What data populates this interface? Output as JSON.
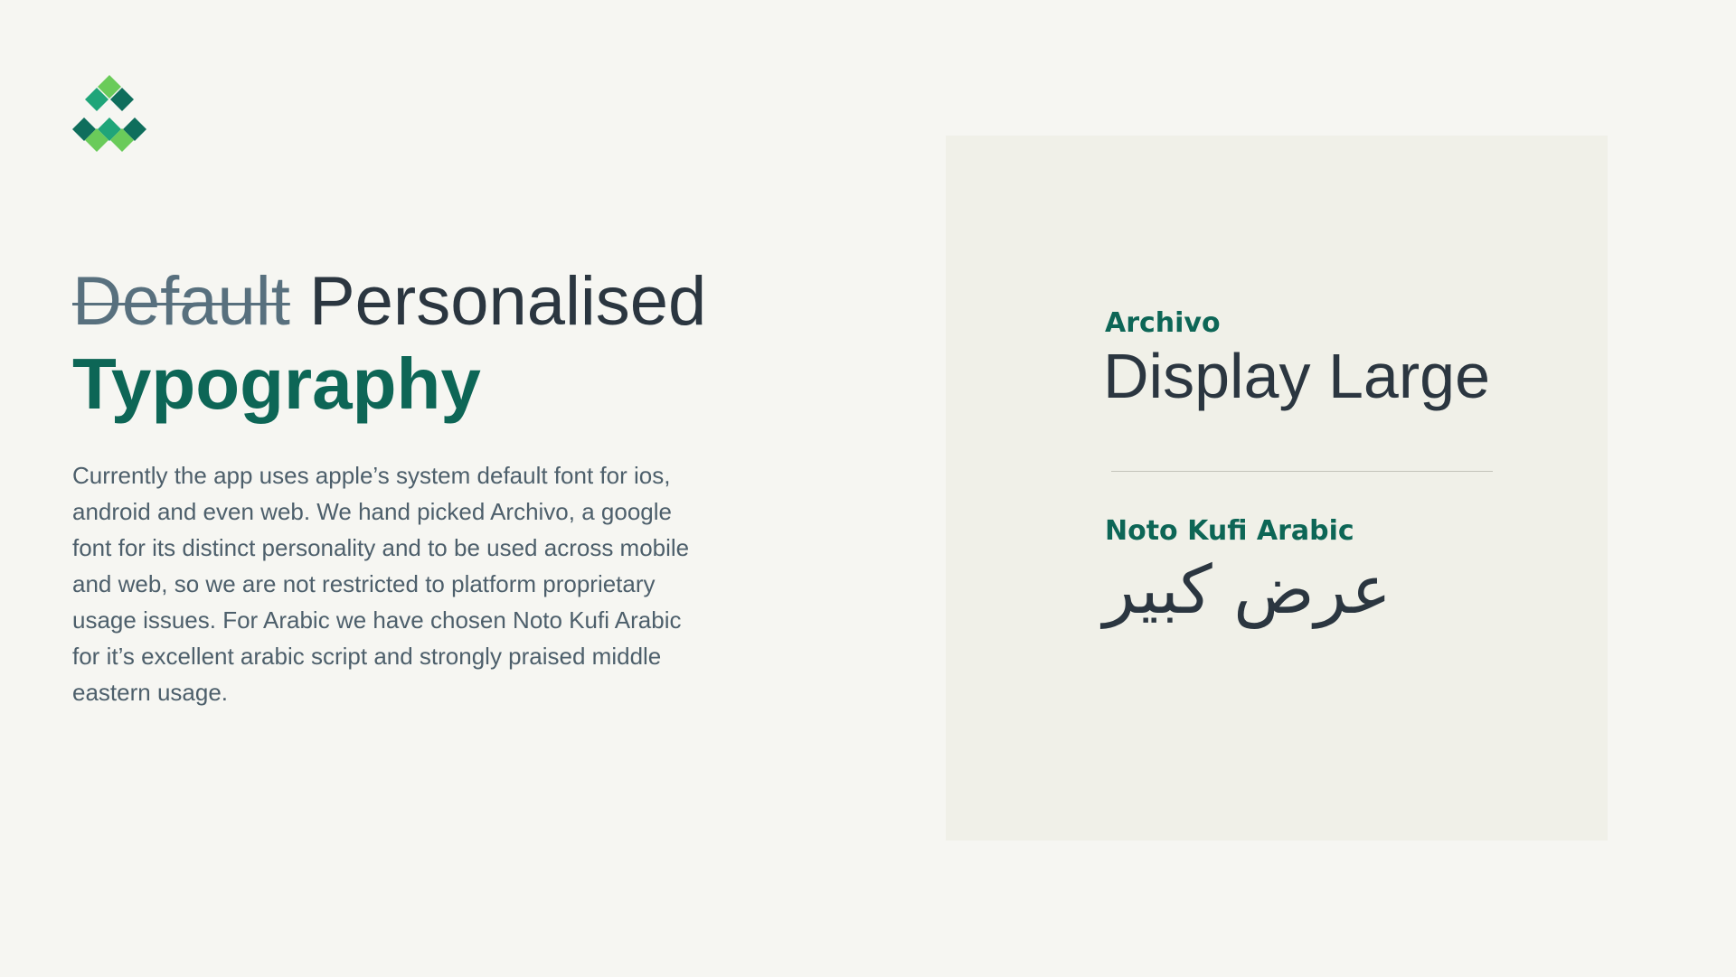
{
  "colors": {
    "background": "#f6f6f2",
    "panel": "#f0f0e8",
    "brand_green": "#0d6656",
    "logo_dark": "#0f6e5c",
    "logo_mid": "#1fa579",
    "logo_light": "#6acb5a",
    "text_dark": "#2b3640",
    "text_muted": "#4d5f6b"
  },
  "logo": {
    "icon": "diamond-mosaic-logo-icon"
  },
  "headline": {
    "struck_word": "Default",
    "word": "Personalised",
    "emphasis": "Typography"
  },
  "description": "Currently the app uses apple’s system default font for ios, android and even web. We hand picked Archivo, a google font for its distinct personality and to be used across mobile and web, so we are not restricted to platform proprietary usage issues. For Arabic we have chosen Noto Kufi Arabic for it’s excellent arabic script and strongly praised middle eastern usage.",
  "specimens": [
    {
      "font_name": "Archivo",
      "sample": "Display Large"
    },
    {
      "font_name": "Noto Kufi Arabic",
      "sample": "عرض كبير"
    }
  ]
}
